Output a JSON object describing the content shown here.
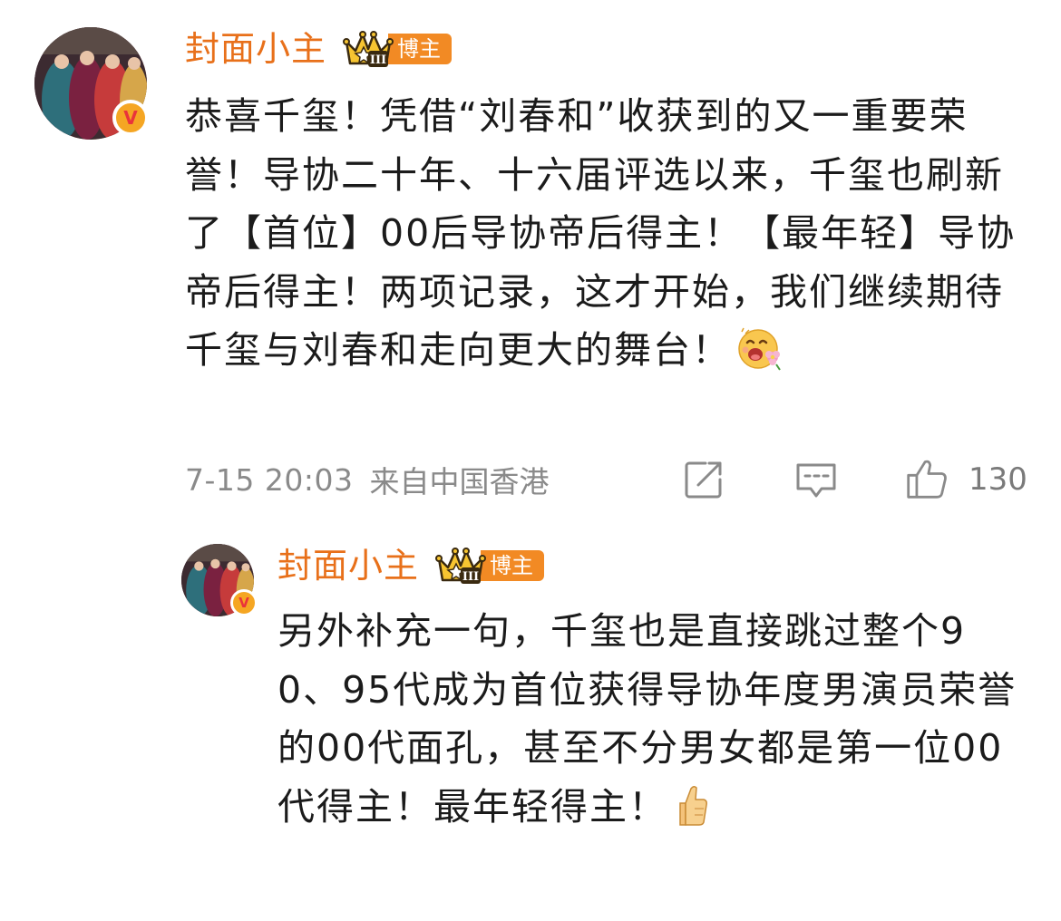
{
  "comment": {
    "username": "封面小主",
    "badge_level": "III",
    "badge_label": "博主",
    "verified_mark": "V",
    "text": "恭喜千玺！凭借“刘春和”收获到的又一重要荣誉！导协二十年、十六届评选以来，千玺也刷新了【首位】00后导协帝后得主！【最年轻】导协帝后得主！两项记录，这才开始，我们继续期待千玺与刘春和走向更大的舞台！",
    "emoji": "flower-smile-emoji",
    "time": "7-15 20:03",
    "location": "来自中国香港",
    "like_count": "130",
    "icons": [
      "share-icon",
      "comment-icon",
      "like-icon"
    ]
  },
  "reply": {
    "username": "封面小主",
    "badge_level": "III",
    "badge_label": "博主",
    "verified_mark": "V",
    "text": "另外补充一句，千玺也是直接跳过整个90、95代成为首位获得导协年度男演员荣誉的00代面孔，甚至不分男女都是第一位00代得主！最年轻得主！",
    "emoji": "thumbs-up-emoji"
  },
  "colors": {
    "username": "#e8701a",
    "badge": "#f28a24",
    "meta": "#8a8a8a"
  }
}
